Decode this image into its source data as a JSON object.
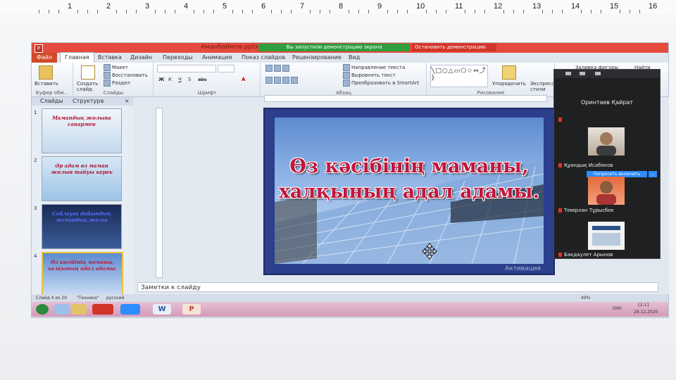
{
  "word_ruler": {
    "numbers": [
      "1",
      "2",
      "3",
      "4",
      "5",
      "6",
      "7",
      "8",
      "9",
      "10",
      "11",
      "12",
      "13",
      "14",
      "15",
      "16"
    ]
  },
  "ppt": {
    "title_bar": {
      "app_icon": "P",
      "doc_title": "Аманбаймов.pptx",
      "share_banner": "Вы запустили демонстрацию экрана",
      "stop_share": "Остановить демонстрацию"
    },
    "tabs": [
      "Файл",
      "Главная",
      "Вставка",
      "Дизайн",
      "Переходы",
      "Анимация",
      "Показ слайдов",
      "Рецензирование",
      "Вид"
    ],
    "ribbon": {
      "groups": [
        {
          "label": "Буфер обм...",
          "items": [
            "Вставить"
          ]
        },
        {
          "label": "Слайды",
          "items": [
            "Создать слайд",
            "Макет",
            "Восстановить",
            "Раздел"
          ]
        },
        {
          "label": "Шрифт",
          "items": [
            "Ж",
            "К",
            "Ч",
            "S",
            "abc",
            "A"
          ]
        },
        {
          "label": "Абзац",
          "items": [
            "Направление текста",
            "Выровнять текст",
            "Преобразовать в SmartArt"
          ]
        },
        {
          "label": "Рисование",
          "items": [
            "Упорядочить",
            "Экспресс-стили"
          ]
        }
      ],
      "right_items": [
        "Заливка фигуры",
        "Найти"
      ]
    },
    "left_pane": {
      "tabs": [
        "Слайды",
        "Структура"
      ],
      "slides": [
        {
          "num": "1",
          "text": "Мамандық жолына сапармен"
        },
        {
          "num": "2",
          "text": "Әр адам өз маман жолын табуы керек"
        },
        {
          "num": "3",
          "text": "Сайлауға дайындық мамандық жолы"
        },
        {
          "num": "4",
          "text": "Өз кәсібінің маманы, халқының адал адамы."
        }
      ]
    },
    "slide": {
      "title_line1": "Өз кәсібінің маманы,",
      "title_line2": "халқының адал адамы."
    },
    "watermark": "Активация",
    "notes_placeholder": "Заметки к слайду",
    "status": {
      "slide_info": "Слайд 4 из 20",
      "theme": "\"Техника\"",
      "language": "русский",
      "zoom": "49%",
      "language_indicator": "ENG",
      "time": "12:11",
      "date": "28.12.2020"
    },
    "taskbar_apps": [
      "start",
      "ie",
      "explorer",
      "ppt-red",
      "zoom",
      "word",
      "powerpoint"
    ]
  },
  "zoom": {
    "host_name": "Оринтаев Қайрат",
    "participants": [
      {
        "name": "Құандық Исабеков"
      },
      {
        "name": "Темірлан Тұрысбек"
      },
      {
        "name": "Бақдаулет Арынов"
      }
    ],
    "request_button": "Попросить включить",
    "more_button": "..."
  },
  "colors": {
    "title_bar": "#e64a3c",
    "share_green": "#2e9e3e",
    "slide_title": "#c0163d",
    "zoom_bg": "#1f2022",
    "zoom_blue": "#2d8cff"
  }
}
